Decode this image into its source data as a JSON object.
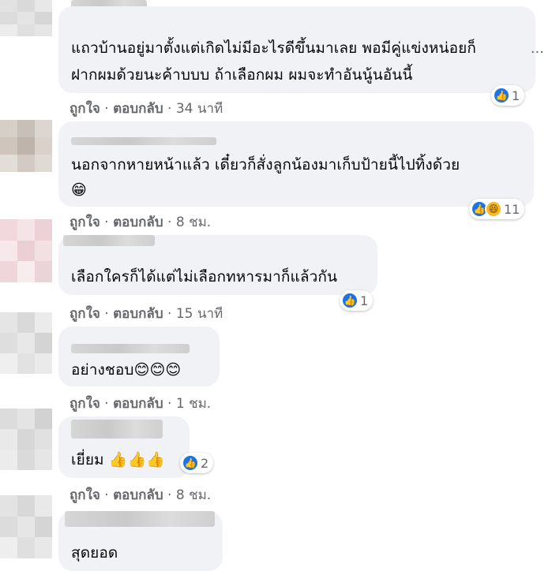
{
  "actions": {
    "like": "ถูกใจ",
    "reply": "ตอบกลับ",
    "separator": "·"
  },
  "colors": {
    "bubble": "#f0f2f5",
    "like_blue": "#1b74e4",
    "meta_gray": "#65676b"
  },
  "comments": [
    {
      "lines": [
        "แถวบ้านอยู่มาตั้งแต่เกิดไม่มีอะไรดีขึ้นมาเลย พอมีคู่แข่งหน่อยก็",
        "ฝากผมด้วยนะค้าบบบ ถ้าเลือกผม ผมจะทำอันนู้นอันนี้"
      ],
      "time": "34 นาที",
      "reactions": [
        "like-icon"
      ],
      "reaction_count": "1"
    },
    {
      "lines": [
        "นอกจากหายหน้าแล้ว เดี๋ยวก็สั่งลูกน้องมาเก็บป้ายนี้ไปทิ้งด้วย"
      ],
      "emoji": "😁",
      "time": "8 ชม.",
      "reactions": [
        "like-icon",
        "haha-icon"
      ],
      "reaction_count": "11"
    },
    {
      "lines": [
        "เลือกใครก็ได้แต่ไม่เลือกทหารมาก็แล้วกัน"
      ],
      "time": "15 นาที",
      "reactions": [
        "like-icon"
      ],
      "reaction_count": "1"
    },
    {
      "lines": [
        "อย่างชอบ"
      ],
      "emoji": "😊😊😊",
      "time": "1 ชม.",
      "reactions": [],
      "reaction_count": ""
    },
    {
      "lines": [
        "เยี่ยม"
      ],
      "emoji": "👍👍👍",
      "time": "8 ชม.",
      "reactions": [
        "like-icon"
      ],
      "reaction_count": "2"
    },
    {
      "lines": [
        "สุดยอด"
      ],
      "time": "",
      "reactions": [],
      "reaction_count": ""
    }
  ],
  "more_options_icon": "more-dots-icon"
}
